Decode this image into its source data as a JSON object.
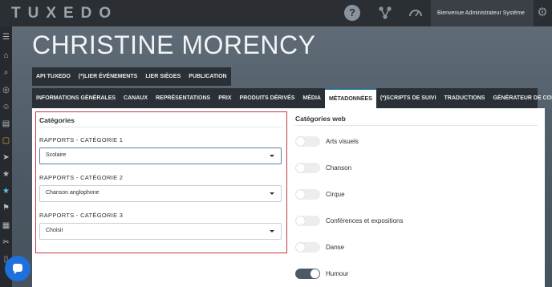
{
  "app": {
    "logo": "TUXEDO"
  },
  "topbar": {
    "welcome": "Bienvenue Administrateur Système"
  },
  "icons": {
    "help": "?",
    "hierarchy": "⚲",
    "gauge": "◠",
    "gear": "⚙"
  },
  "sidebar": {
    "icons": [
      "☰",
      "⌂",
      "⌕",
      "◎",
      "☺",
      "▤",
      "▢",
      "➤",
      "★",
      "★",
      "⚑",
      "▦",
      "✂",
      "▯"
    ]
  },
  "header": {
    "name": "CHRISTINE MORENCY"
  },
  "tabs_primary": [
    "API TUXEDO",
    "(*)LIER ÉVÉNEMENTS",
    "LIER SIÈGES",
    "PUBLICATION"
  ],
  "tabs_secondary": [
    "INFORMATIONS GÉNÉRALES",
    "CANAUX",
    "REPRÉSENTATIONS",
    "PRIX",
    "PRODUITS DÉRIVÉS",
    "MÉDIA",
    "MÉTADONNÉES",
    "(*)SCRIPTS DE SUIVI",
    "TRADUCTIONS",
    "GÉNÉRATEUR DE CODES"
  ],
  "active_tab": "MÉTADONNÉES",
  "categories": {
    "title": "Catégories",
    "fields": [
      {
        "label": "RAPPORTS - CATÉGORIE 1",
        "value": "Scolaire"
      },
      {
        "label": "RAPPORTS - CATÉGORIE 2",
        "value": "Chanson anglophone"
      },
      {
        "label": "RAPPORTS - CATÉGORIE 3",
        "value": "Choisir"
      }
    ]
  },
  "web_categories": {
    "title": "Catégories web",
    "items": [
      {
        "label": "Arts visuels",
        "enabled": false
      },
      {
        "label": "Chanson",
        "enabled": false
      },
      {
        "label": "Cirque",
        "enabled": false
      },
      {
        "label": "Conférences et expositions",
        "enabled": false
      },
      {
        "label": "Danse",
        "enabled": false
      },
      {
        "label": "Humour",
        "enabled": true
      }
    ]
  },
  "colors": {
    "accent": "#2d6f94",
    "highlight_border": "#c4383d",
    "chat": "#1f6fdc"
  }
}
